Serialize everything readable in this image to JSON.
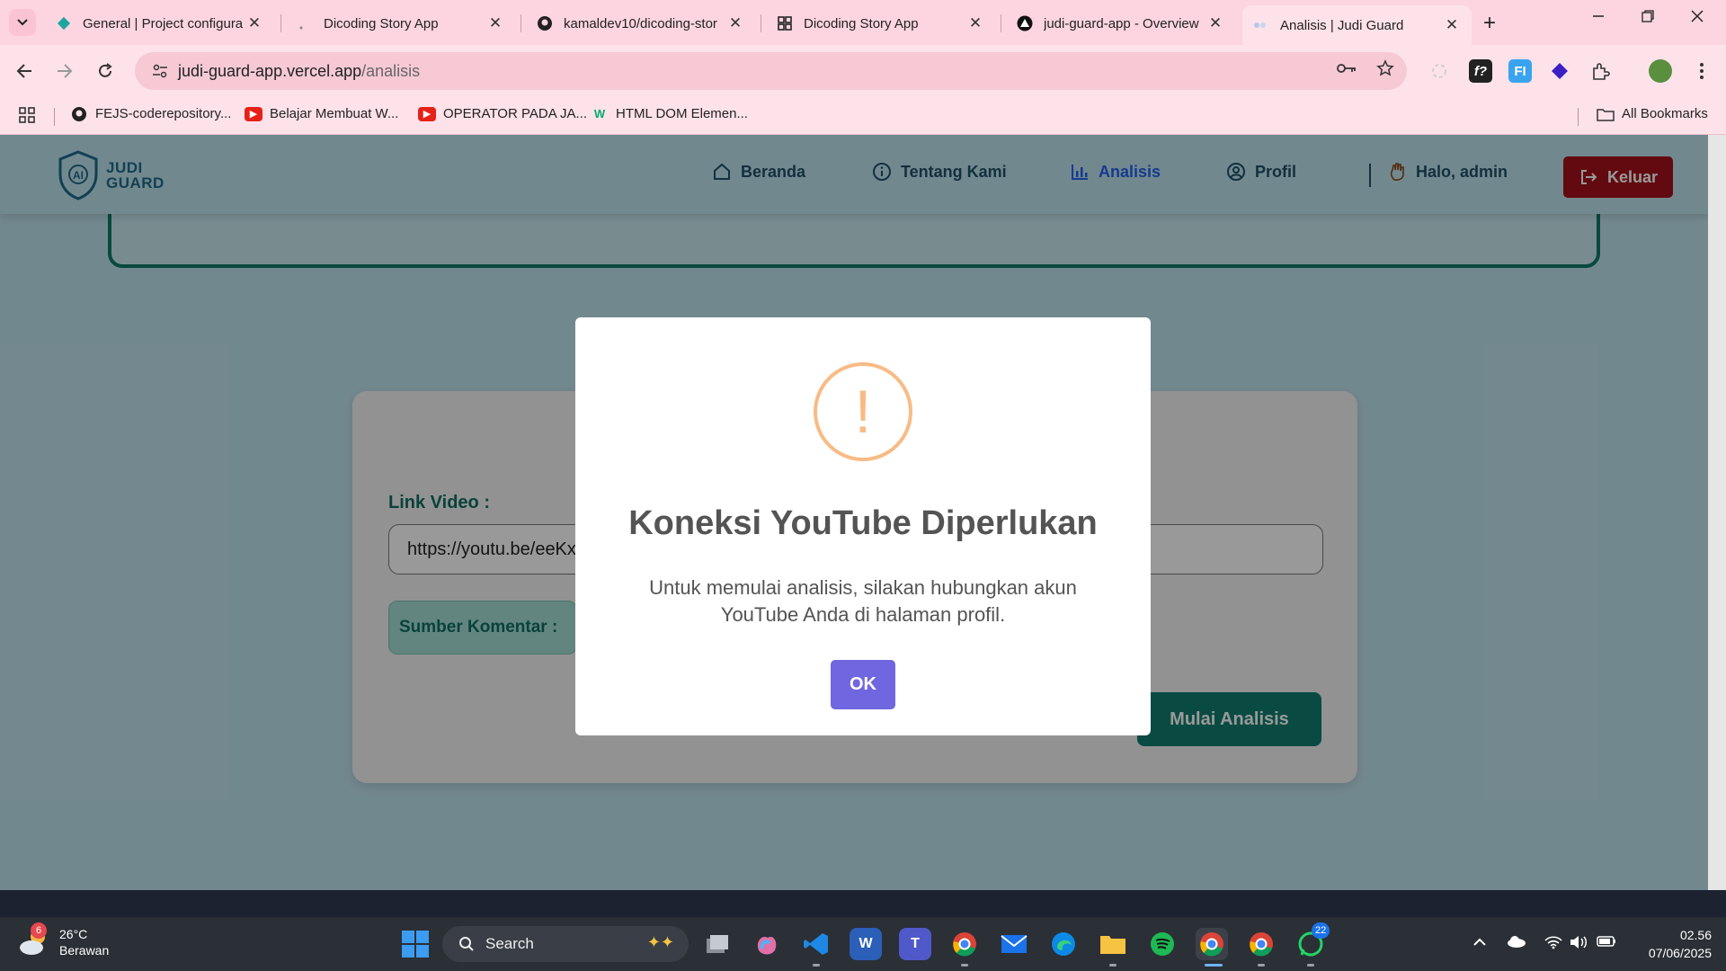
{
  "browser": {
    "tabs": [
      {
        "title": "General | Project configura",
        "close": "✕"
      },
      {
        "title": "Dicoding Story App",
        "close": "✕"
      },
      {
        "title": "kamaldev10/dicoding-stor",
        "close": "✕"
      },
      {
        "title": "Dicoding Story App",
        "close": "✕"
      },
      {
        "title": "judi-guard-app - Overview",
        "close": "✕"
      },
      {
        "title": "Analisis | Judi Guard",
        "close": "✕"
      }
    ],
    "new_tab": "+",
    "url_host": "judi-guard-app.vercel.app",
    "url_path": "/analisis",
    "bookmarks": [
      {
        "label": "FEJS-coderepository..."
      },
      {
        "label": "Belajar Membuat W..."
      },
      {
        "label": "OPERATOR PADA JA..."
      },
      {
        "label": "HTML DOM Elemen..."
      }
    ],
    "all_bookmarks": "All Bookmarks",
    "extensions": [
      "f?",
      "FI"
    ]
  },
  "site": {
    "logo_line1": "JUDI",
    "logo_line2": "GUARD",
    "logo_badge": "AI",
    "nav": {
      "home": "Beranda",
      "about": "Tentang Kami",
      "analysis": "Analisis",
      "profile": "Profil",
      "greeting": "Halo, admin",
      "logout": "Keluar"
    },
    "form": {
      "link_label": "Link Video :",
      "link_value": "https://youtu.be/eeKx",
      "source_label": "Sumber Komentar :",
      "start_button": "Mulai Analisis"
    }
  },
  "modal": {
    "icon": "!",
    "title": "Koneksi YouTube Diperlukan",
    "text": "Untuk memulai analisis, silakan hubungkan akun YouTube Anda di halaman profil.",
    "ok": "OK",
    "colors": {
      "warning": "#f8bb86",
      "confirm": "#7066e0"
    }
  },
  "taskbar": {
    "weather_temp": "26°C",
    "weather_desc": "Berawan",
    "weather_badge": "6",
    "search_placeholder": "Search",
    "whatsapp_badge": "22",
    "time": "02.56",
    "date": "07/06/2025"
  }
}
